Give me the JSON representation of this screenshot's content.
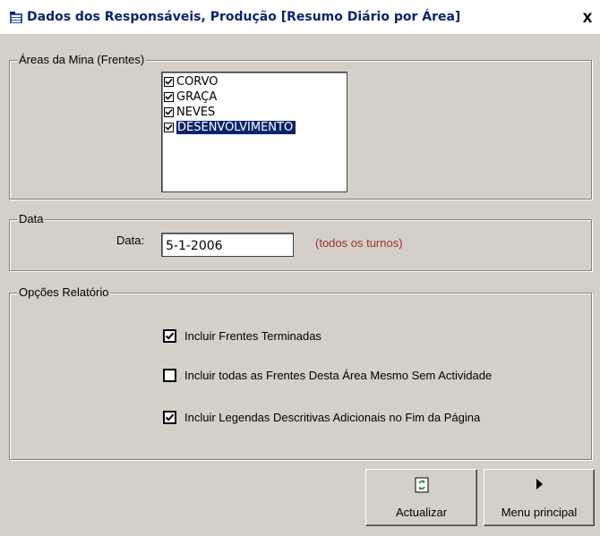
{
  "window": {
    "title": "Dados dos Responsáveis, Produção [Resumo Diário por Área]",
    "close_label": "X"
  },
  "areas": {
    "legend": "Áreas da Mina (Frentes)",
    "items": [
      {
        "label": "CORVO",
        "checked": true
      },
      {
        "label": "GRAÇA",
        "checked": true
      },
      {
        "label": "NEVES",
        "checked": true
      },
      {
        "label": "DESENVOLVIMENTO",
        "checked": true,
        "selected": true
      }
    ]
  },
  "data_section": {
    "legend": "Data",
    "label": "Data:",
    "value": "5-1-2006",
    "hint": "(todos os turnos)"
  },
  "options": {
    "legend": "Opções Relatório",
    "items": [
      {
        "label": "Incluir Frentes Terminadas",
        "checked": true
      },
      {
        "label": "Incluir todas as Frentes Desta Área Mesmo Sem Actividade",
        "checked": false
      },
      {
        "label": "Incluir Legendas Descritivas Adicionais no Fim da Página",
        "checked": true
      }
    ]
  },
  "buttons": {
    "update_label": "Actualizar",
    "main_menu_label": "Menu principal"
  },
  "colors": {
    "title_text": "#0a246a",
    "selection": "#0a246a",
    "hint": "#993333",
    "face": "#d4d0c8"
  },
  "icons": {
    "window": "database-icon",
    "update": "refresh-icon",
    "main_menu": "play-arrow-icon"
  }
}
